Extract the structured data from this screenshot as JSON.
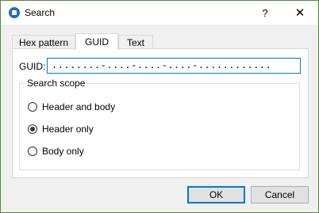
{
  "window": {
    "title": "Search",
    "help": "?",
    "close": "✕"
  },
  "tabs": [
    {
      "label": "Hex pattern",
      "active": false
    },
    {
      "label": "GUID",
      "active": true
    },
    {
      "label": "Text",
      "active": false
    }
  ],
  "guid": {
    "label": "GUID:",
    "value": "........-....-....-....-............"
  },
  "scope": {
    "title": "Search scope",
    "options": [
      {
        "label": "Header and body",
        "checked": false
      },
      {
        "label": "Header only",
        "checked": true
      },
      {
        "label": "Body only",
        "checked": false
      }
    ]
  },
  "buttons": {
    "ok": "OK",
    "cancel": "Cancel"
  },
  "colors": {
    "border": "#4f8a3c",
    "accent": "#0078d7"
  },
  "icons": {
    "app": "app-icon",
    "close": "close-icon",
    "help": "help-icon"
  }
}
